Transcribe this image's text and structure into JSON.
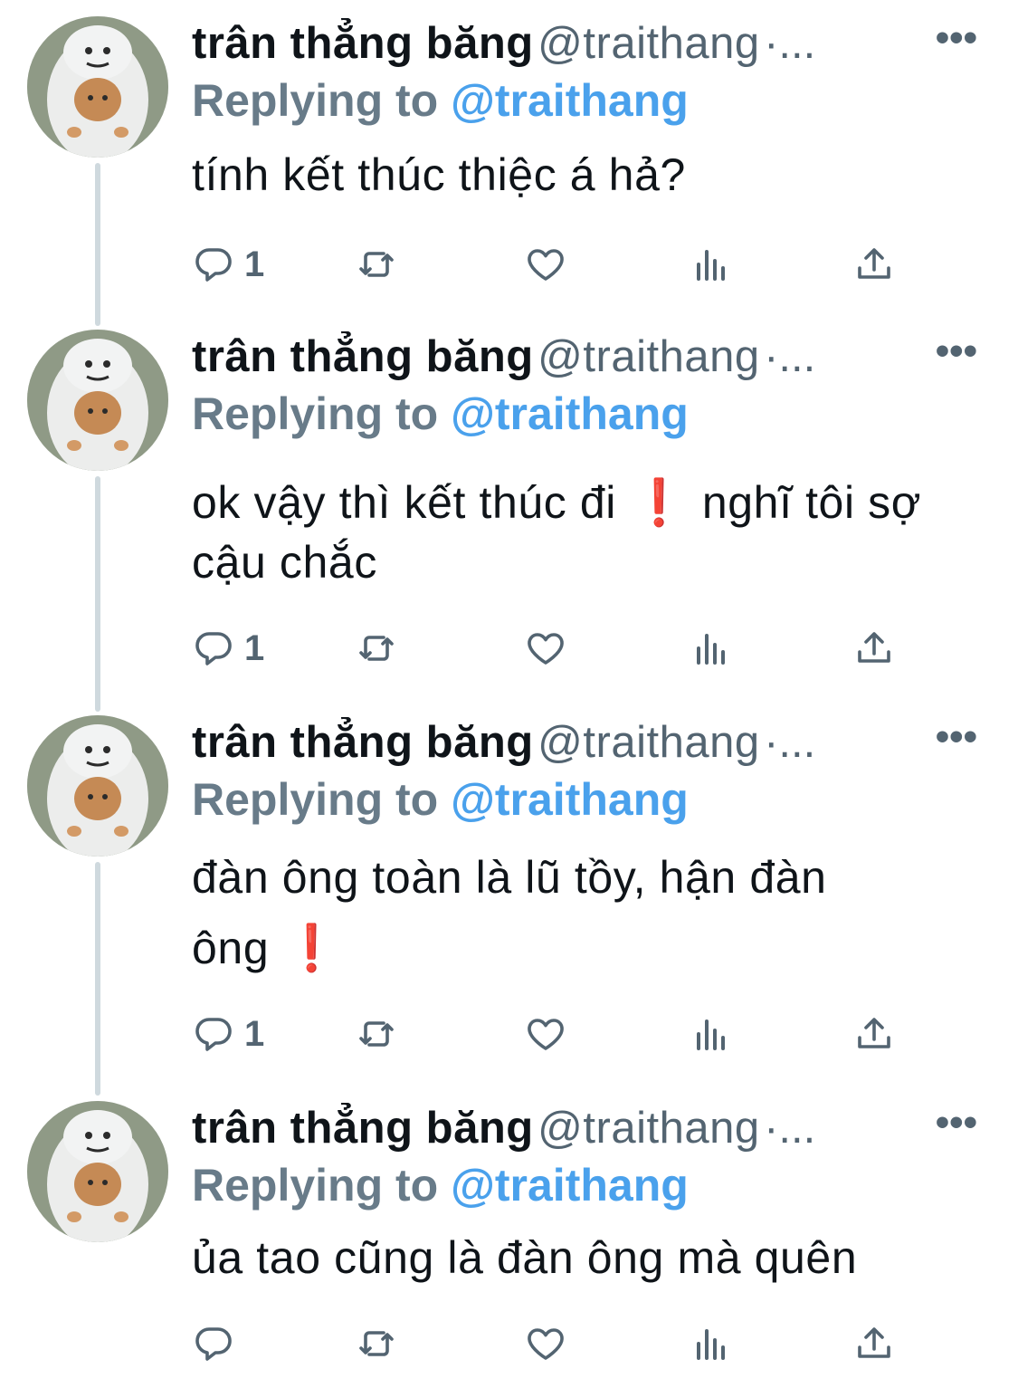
{
  "colors": {
    "text": "#0f1419",
    "muted": "#536471",
    "link": "#4aa1ec",
    "alert": "#d12b2b",
    "thread_line": "#cfd9de"
  },
  "tweets": [
    {
      "display_name": "trân thẳng băng",
      "handle": "@traithang",
      "sep": "·...",
      "more": "•••",
      "reply_label": "Replying to",
      "reply_handle": "@traithang",
      "text_lines": [
        "tính kết thúc thiệc á hả?"
      ],
      "reply_count": "1"
    },
    {
      "display_name": "trân thẳng băng",
      "handle": "@traithang",
      "sep": "·...",
      "more": "•••",
      "reply_label": "Replying to",
      "reply_handle": "@traithang",
      "text_a": "ok vậy thì kết thúc đi",
      "text_mark": "❗",
      "text_b": "nghĩ tôi sợ",
      "text_c": "cậu chắc",
      "reply_count": "1"
    },
    {
      "display_name": "trân thẳng băng",
      "handle": "@traithang",
      "sep": "·...",
      "more": "•••",
      "reply_label": "Replying to",
      "reply_handle": "@traithang",
      "text_a": "đàn ông toàn là lũ tồy, hận đàn",
      "text_b": "ông",
      "text_mark": "❗",
      "reply_count": "1"
    },
    {
      "display_name": "trân thẳng băng",
      "handle": "@traithang",
      "sep": "·...",
      "more": "•••",
      "reply_label": "Replying to",
      "reply_handle": "@traithang",
      "text_lines": [
        "ủa tao cũng là đàn ông mà quên"
      ],
      "reply_count": ""
    }
  ],
  "icons": {
    "reply": "reply-icon",
    "retweet": "retweet-icon",
    "like": "heart-icon",
    "views": "views-icon",
    "share": "share-icon",
    "more": "more-icon"
  }
}
